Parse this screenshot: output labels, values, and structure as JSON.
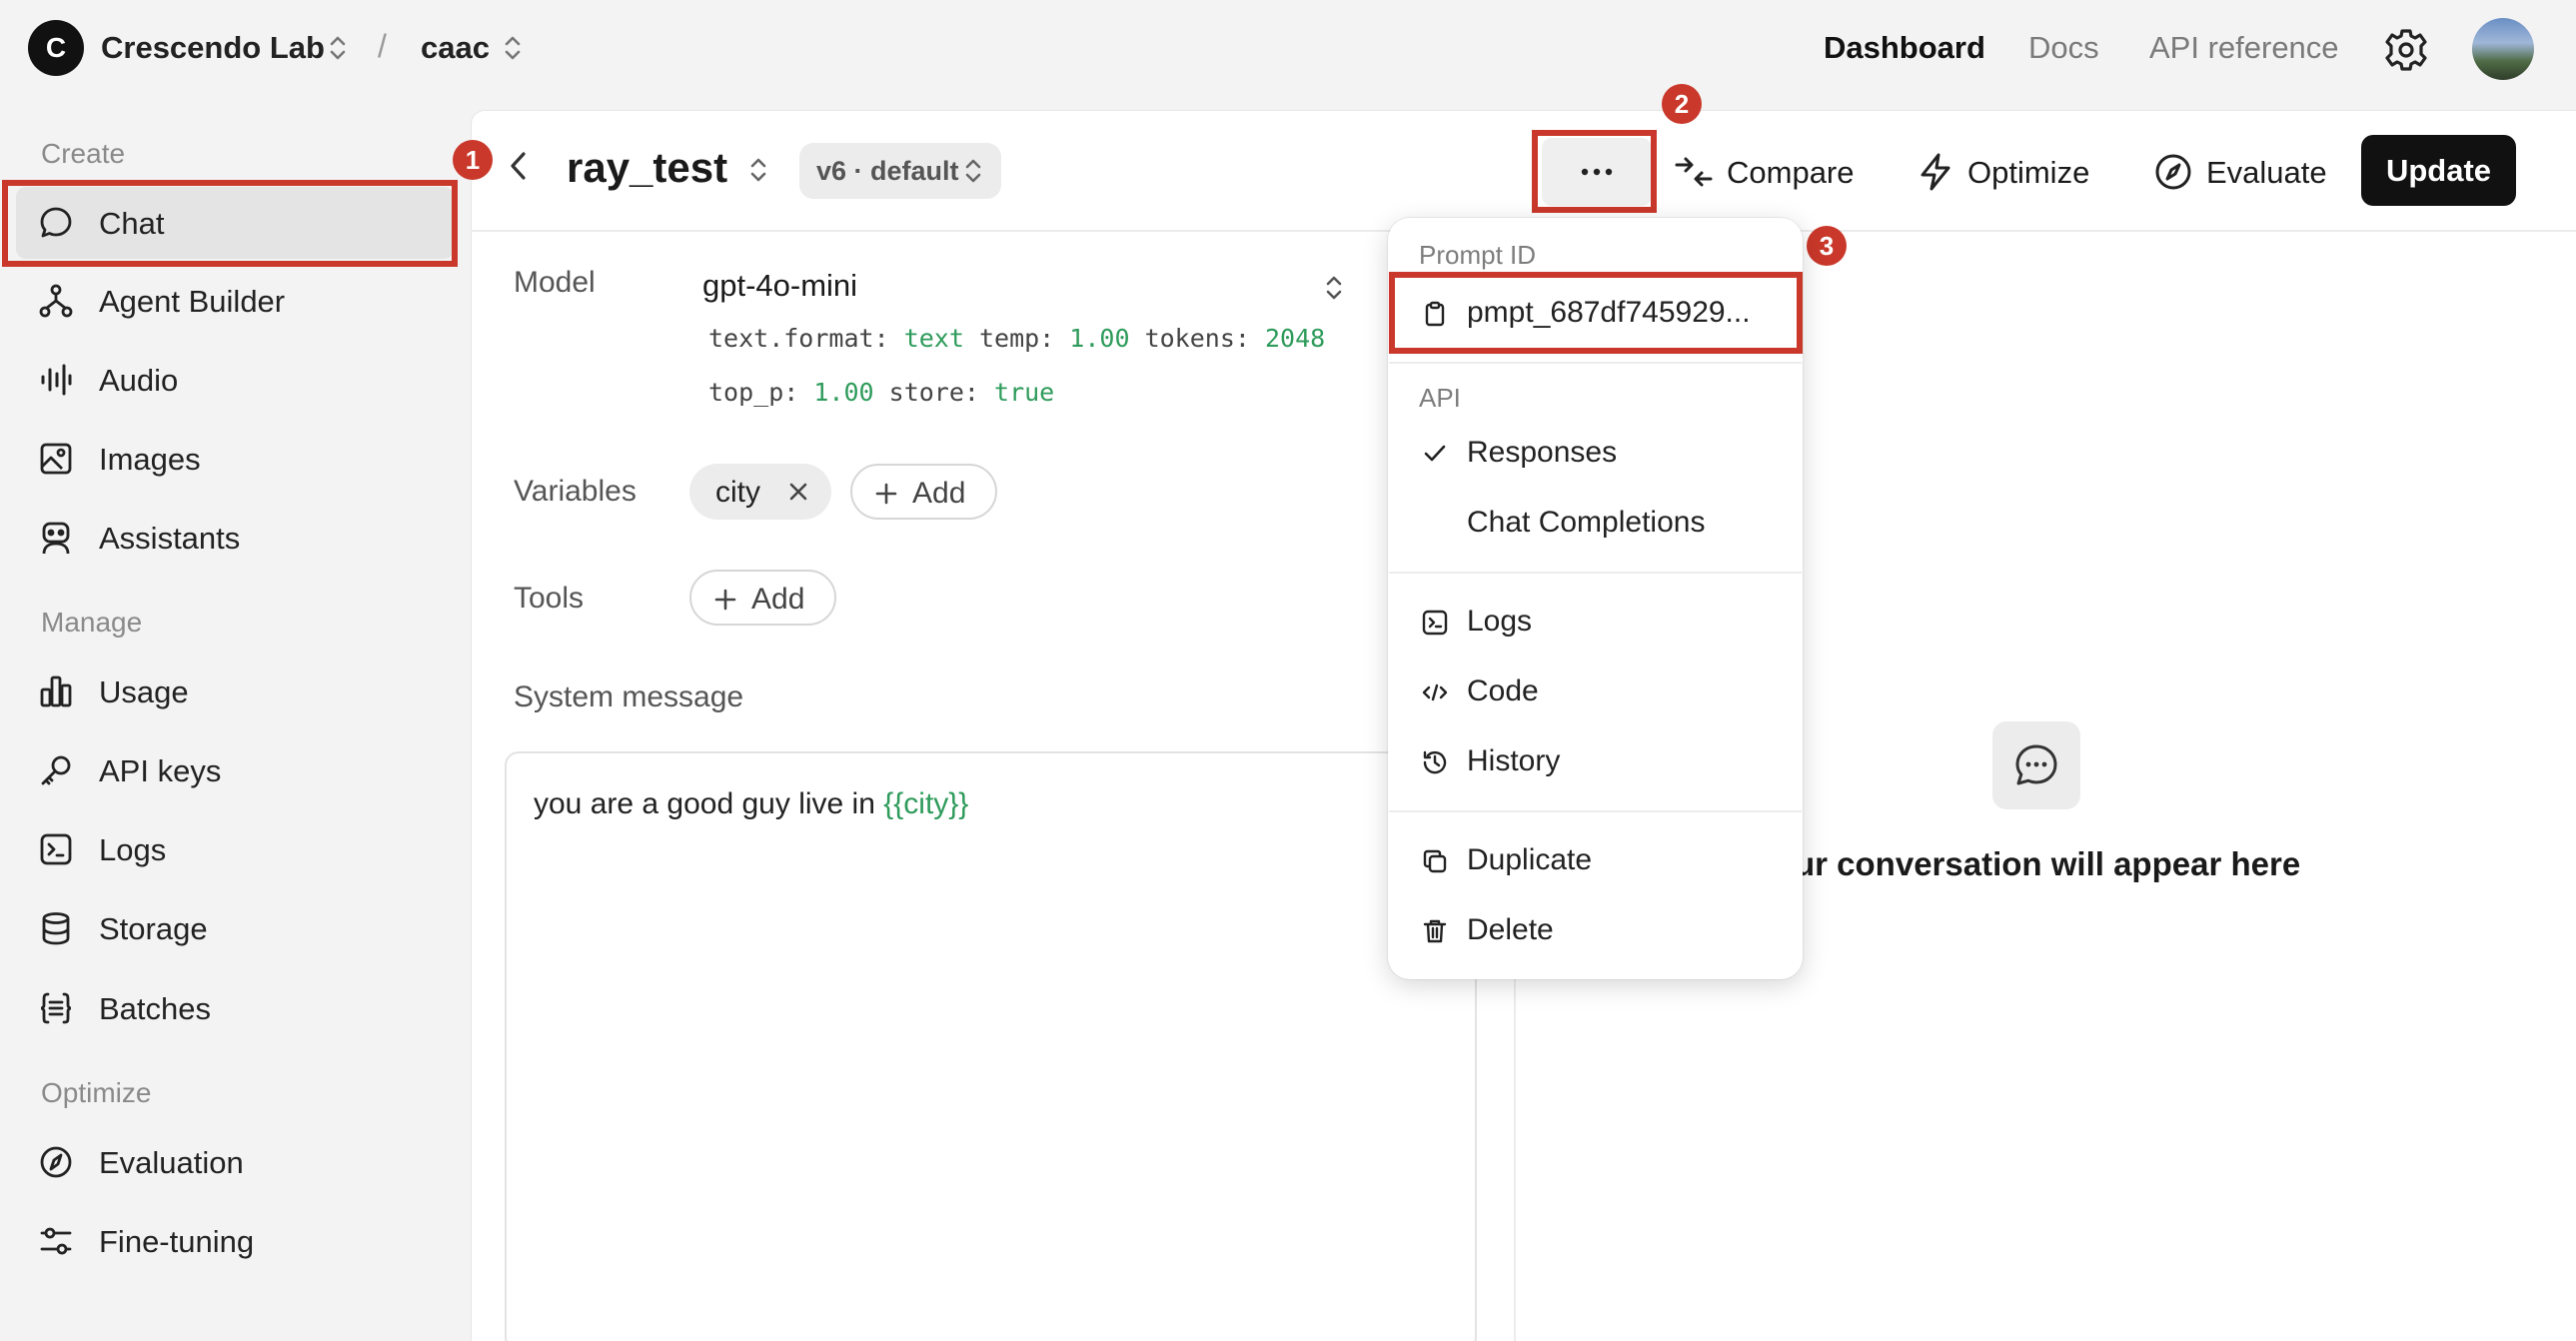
{
  "header": {
    "org_initial": "C",
    "org_name": "Crescendo Lab",
    "separator": "/",
    "project_name": "caac",
    "nav": [
      {
        "label": "Dashboard",
        "active": true
      },
      {
        "label": "Docs",
        "active": false
      },
      {
        "label": "API reference",
        "active": false
      }
    ]
  },
  "sidebar": {
    "sections": [
      {
        "title": "Create",
        "items": [
          {
            "label": "Chat",
            "icon": "chat-bubble-icon",
            "active": true
          },
          {
            "label": "Agent Builder",
            "icon": "agent-flow-icon"
          },
          {
            "label": "Audio",
            "icon": "audio-wave-icon"
          },
          {
            "label": "Images",
            "icon": "image-icon"
          },
          {
            "label": "Assistants",
            "icon": "robot-icon"
          }
        ]
      },
      {
        "title": "Manage",
        "items": [
          {
            "label": "Usage",
            "icon": "bar-chart-icon"
          },
          {
            "label": "API keys",
            "icon": "key-icon"
          },
          {
            "label": "Logs",
            "icon": "terminal-icon"
          },
          {
            "label": "Storage",
            "icon": "database-icon"
          },
          {
            "label": "Batches",
            "icon": "batch-braces-icon"
          }
        ]
      },
      {
        "title": "Optimize",
        "items": [
          {
            "label": "Evaluation",
            "icon": "compass-icon"
          },
          {
            "label": "Fine-tuning",
            "icon": "sliders-icon"
          }
        ]
      }
    ]
  },
  "toolbar": {
    "prompt_name": "ray_test",
    "version_label": "v6 · default",
    "compare_label": "Compare",
    "optimize_label": "Optimize",
    "evaluate_label": "Evaluate",
    "update_label": "Update"
  },
  "annotations": {
    "badge1": "1",
    "badge2": "2",
    "badge3": "3",
    "highlight_color": "#c9382a"
  },
  "config": {
    "model_label": "Model",
    "model_value": "gpt-4o-mini",
    "params_line1": [
      {
        "key": "text.format:",
        "value": "text"
      },
      {
        "key": "temp:",
        "value": "1.00"
      },
      {
        "key": "tokens:",
        "value": "2048"
      }
    ],
    "params_line2": [
      {
        "key": "top_p:",
        "value": "1.00"
      },
      {
        "key": "store:",
        "value": "true"
      }
    ],
    "variables_label": "Variables",
    "variable_chip": "city",
    "add_label": "Add",
    "tools_label": "Tools",
    "system_message_label": "System message",
    "system_message_text": "you are a good guy live in ",
    "system_message_var": "{{city}}"
  },
  "chat_pane": {
    "empty_text": "ur conversation will appear here"
  },
  "dropdown": {
    "prompt_id_section": "Prompt ID",
    "prompt_id_value": "pmpt_687df745929...",
    "api_section": "API",
    "api_options": [
      {
        "label": "Responses",
        "checked": true
      },
      {
        "label": "Chat Completions",
        "checked": false
      }
    ],
    "group2": [
      {
        "label": "Logs",
        "icon": "terminal-icon"
      },
      {
        "label": "Code",
        "icon": "code-icon"
      },
      {
        "label": "History",
        "icon": "history-icon"
      }
    ],
    "group3": [
      {
        "label": "Duplicate",
        "icon": "duplicate-icon"
      },
      {
        "label": "Delete",
        "icon": "trash-icon"
      }
    ]
  },
  "colors": {
    "accent_green": "#2e9b5b",
    "annotation_red": "#c9382a",
    "primary_button": "#111111"
  }
}
